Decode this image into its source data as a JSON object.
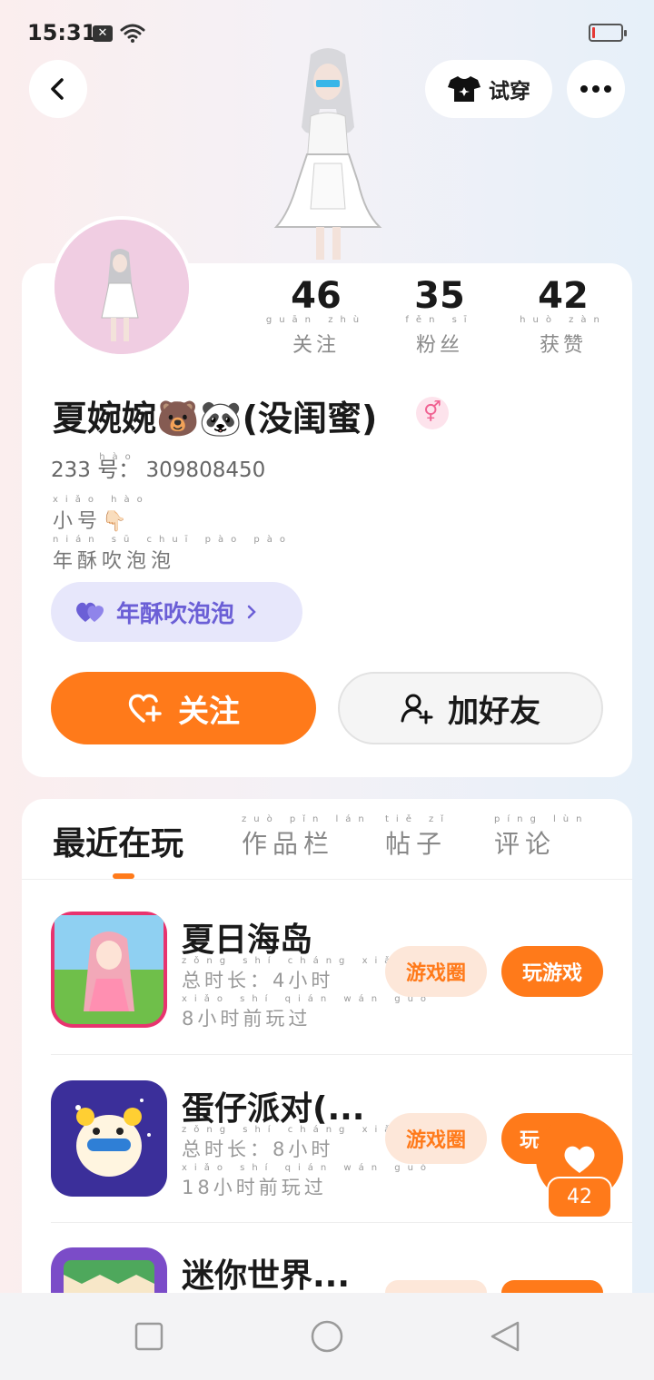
{
  "status_bar": {
    "time": "15:31",
    "notification_icon": "x-badge-icon",
    "wifi_icon": "wifi-icon",
    "battery_level": 0.1
  },
  "header": {
    "try_on_label": "试穿"
  },
  "stats": [
    {
      "value": "46",
      "label": "关注",
      "pinyin": "guān zhù"
    },
    {
      "value": "35",
      "label": "粉丝",
      "pinyin": "fěn sī"
    },
    {
      "value": "42",
      "label": "获赞",
      "pinyin": "huò zàn"
    }
  ],
  "profile": {
    "nickname": "夏婉婉🐻🐼(没闺蜜)",
    "gender_icon": "⚥",
    "id_prefix": "233",
    "id_prefix_pinyin": "hào",
    "id_label": "号：",
    "id_value": "309808450",
    "alt_line1": "小号👇🏻",
    "alt_line1_pinyin": "xiǎo hào",
    "alt_line2": "年酥吹泡泡",
    "alt_line2_pinyin": "nián sū chuī pào pào",
    "bubble_tag_label": "年酥吹泡泡"
  },
  "actions": {
    "follow_label": "关注",
    "add_friend_label": "加好友"
  },
  "tabs": [
    {
      "label": "最近在玩",
      "pinyin": ""
    },
    {
      "label": "作品栏",
      "pinyin": "zuò pǐn lán"
    },
    {
      "label": "帖子",
      "pinyin": "tiě zǐ"
    },
    {
      "label": "评论",
      "pinyin": "píng lùn"
    }
  ],
  "games": [
    {
      "name": "夏日海岛",
      "duration": "总时长：4小时",
      "duration_pinyin": "zǒng shí cháng xiǎo shí",
      "last_played": "8小时前玩过",
      "last_played_pinyin": "xiǎo shí qián wán guò",
      "circle_label": "游戏圈",
      "play_label": "玩游戏"
    },
    {
      "name": "蛋仔派对(...",
      "duration": "总时长：8小时",
      "duration_pinyin": "zǒng shí cháng xiǎo shí",
      "last_played": "18小时前玩过",
      "last_played_pinyin": "xiǎo shí qián wán guò",
      "circle_label": "游戏圈",
      "play_label": "玩"
    },
    {
      "name": "迷你世界...",
      "circle_label": "",
      "play_label": ""
    }
  ],
  "like": {
    "count": "42"
  },
  "colors": {
    "accent": "#ff7a1a",
    "bubble": "#6b5fd6"
  }
}
